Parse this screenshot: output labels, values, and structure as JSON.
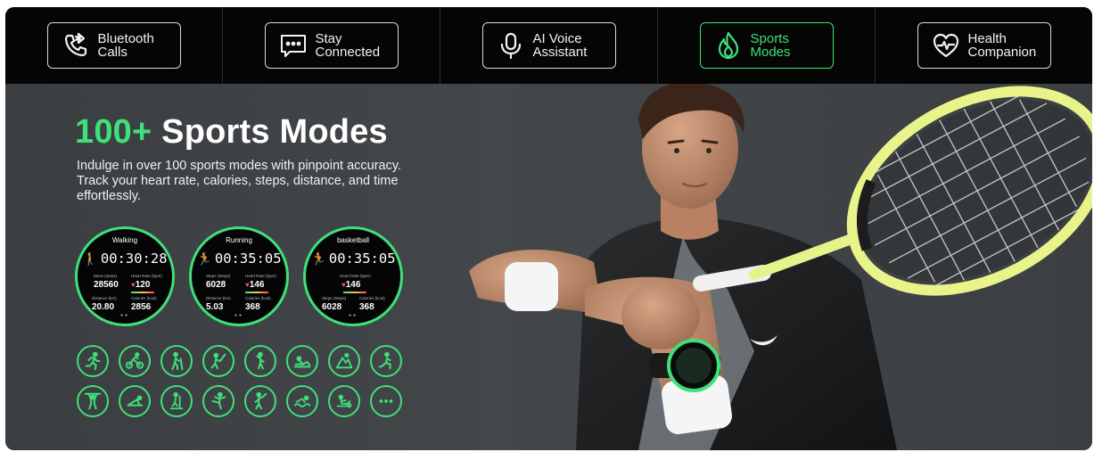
{
  "nav": {
    "items": [
      {
        "line1": "Bluetooth",
        "line2": "Calls",
        "icon": "phone-bluetooth-icon",
        "active": false
      },
      {
        "line1": "Stay",
        "line2": "Connected",
        "icon": "chat-bubble-icon",
        "active": false
      },
      {
        "line1": "AI Voice",
        "line2": "Assistant",
        "icon": "microphone-icon",
        "active": false
      },
      {
        "line1": "Sports",
        "line2": "Modes",
        "icon": "flame-icon",
        "active": true
      },
      {
        "line1": "Health",
        "line2": "Companion",
        "icon": "heart-pulse-icon",
        "active": false
      }
    ]
  },
  "hero": {
    "title_accent": "100+",
    "title_rest": "Sports Modes",
    "description": "Indulge in over 100 sports modes with pinpoint accuracy. Track your heart rate, calories, steps, distance, and time effortlessly."
  },
  "watches": [
    {
      "name": "Walking",
      "time": "00:30:28",
      "g1": "Move (steps)",
      "v1": "28560",
      "g2": "Heart Rate (bpm)",
      "v2": "120",
      "g3": "Distance (km)",
      "v3": "20.80",
      "g4": "Calories (kcal)",
      "v4": "2856"
    },
    {
      "name": "Running",
      "time": "00:35:05",
      "g1": "Steps (Steps)",
      "v1": "6028",
      "g2": "Heart Rate (bpm)",
      "v2": "146",
      "g3": "Distance (km)",
      "v3": "5.03",
      "g4": "Calories (kcal)",
      "v4": "368"
    },
    {
      "name": "basketball",
      "time": "00:35:05",
      "g1": "",
      "v1": "",
      "g2": "Heart Rate (bpm)",
      "v2": "146",
      "g3": "Steps (Steps)",
      "v3": "6028",
      "g4": "Calories (kcal)",
      "v4": "368"
    }
  ],
  "sport_icons": [
    "running-icon",
    "cycling-icon",
    "hiking-icon",
    "cricket-icon",
    "dance-icon",
    "situps-icon",
    "climbing-icon",
    "lunge-icon",
    "weightlifting-icon",
    "yoga-plank-icon",
    "elliptical-icon",
    "yoga-pose-icon",
    "badminton-icon",
    "swimming-icon",
    "rowing-icon",
    "more-icon"
  ],
  "colors": {
    "accent": "#3fe07a",
    "nav_bg": "#050505",
    "hero_bg": "#3d4144",
    "heart": "#ff4d6d"
  }
}
